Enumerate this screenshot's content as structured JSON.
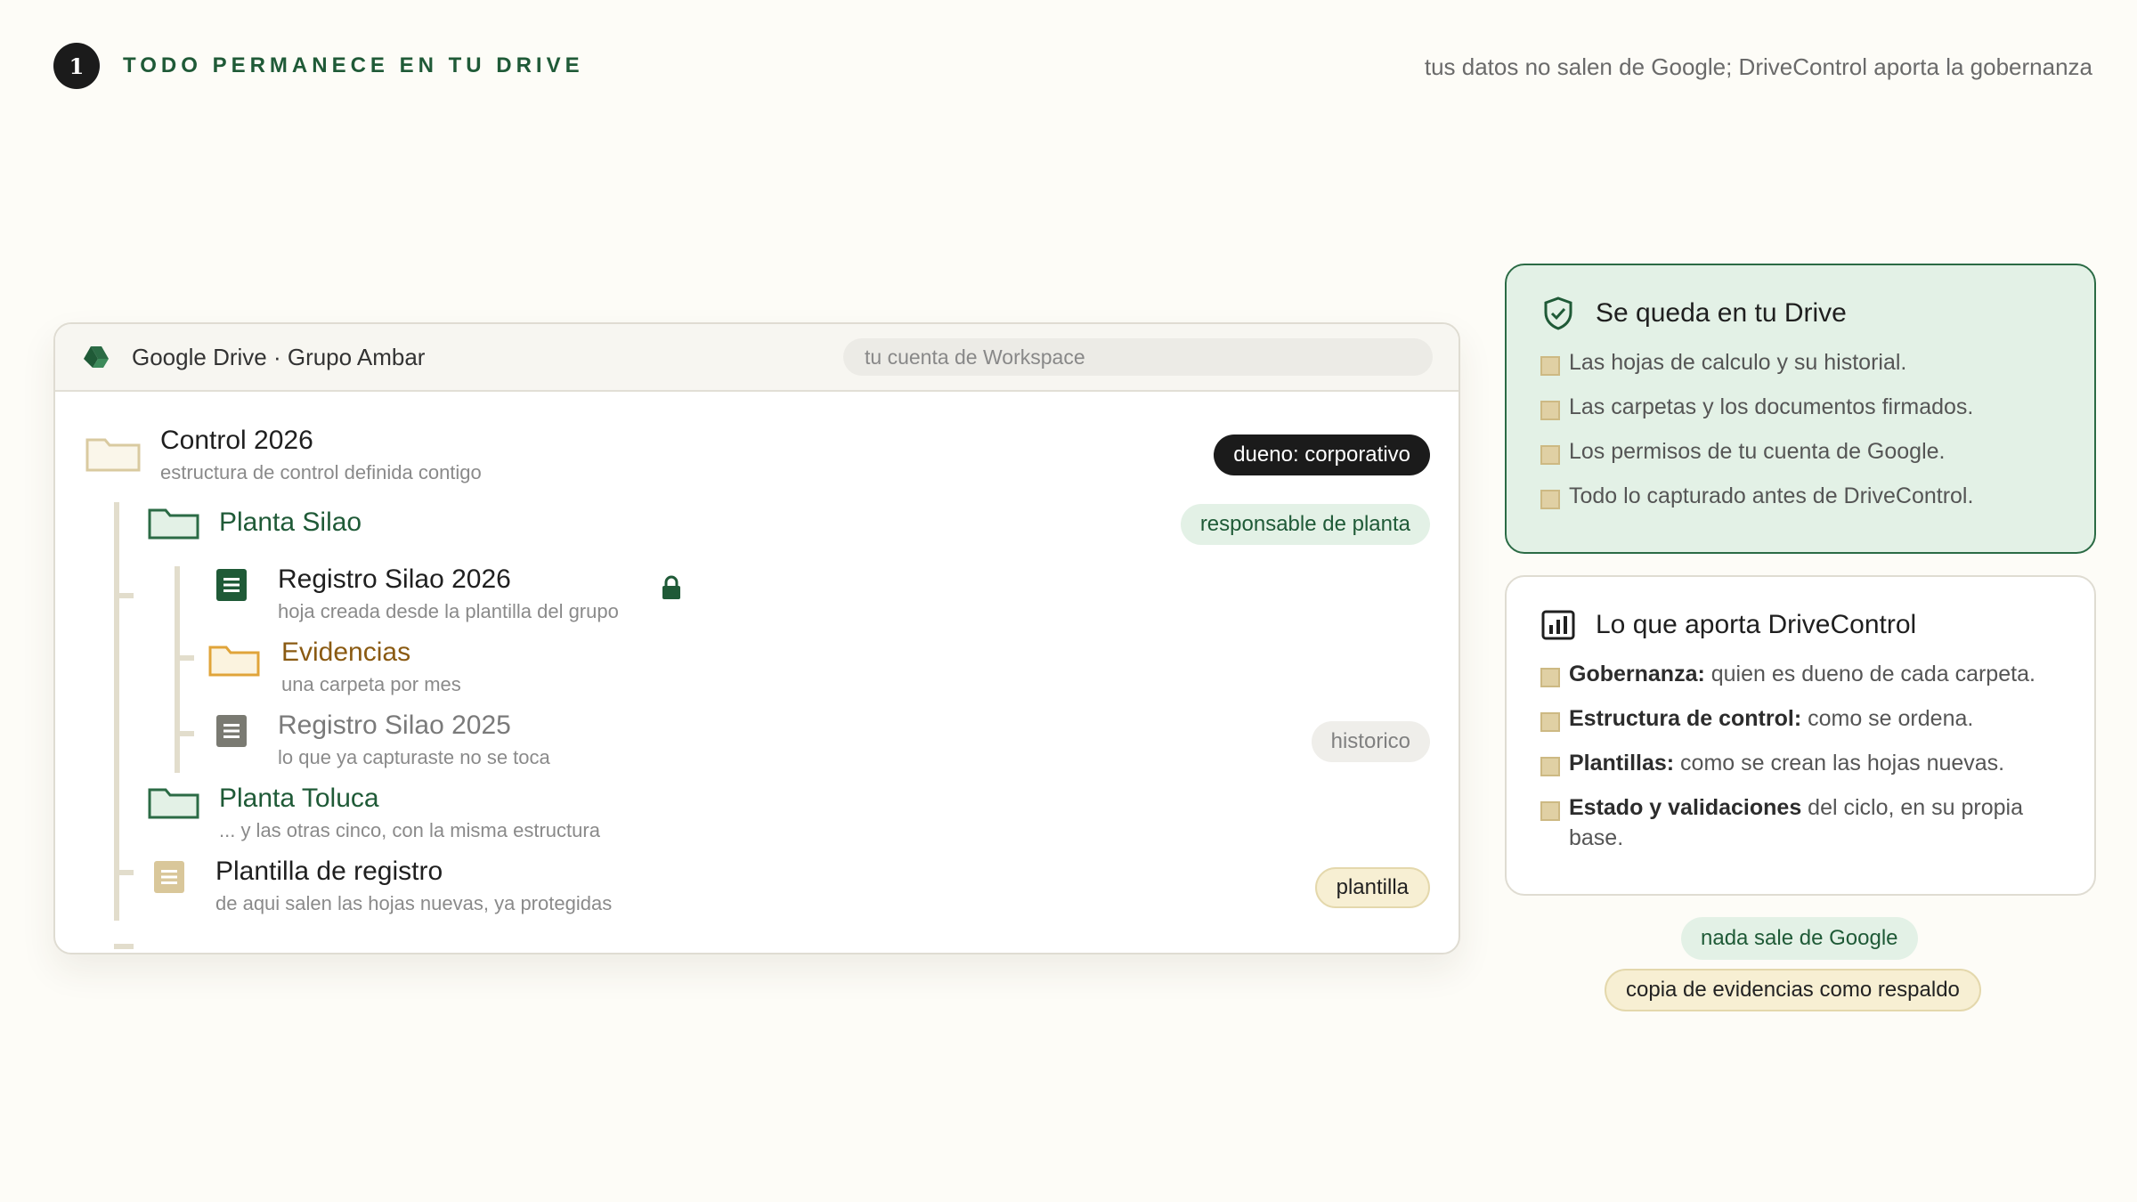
{
  "header": {
    "step_number": "1",
    "step_title": "TODO PERMANECE EN TU DRIVE",
    "note": "tus datos no salen de Google; DriveControl aporta la gobernanza"
  },
  "drive": {
    "title": "Google Drive · Grupo Ambar",
    "search_placeholder": "tu cuenta de Workspace",
    "items": [
      {
        "title": "Control 2026",
        "subtitle": "estructura de control definida contigo",
        "badge": "dueno: corporativo"
      },
      {
        "title": "Planta Silao",
        "subtitle": "",
        "badge": "responsable de planta"
      },
      {
        "title": "Registro Silao 2026",
        "subtitle": "hoja creada desde la plantilla del grupo",
        "badge": ""
      },
      {
        "title": "Evidencias",
        "subtitle": "una carpeta por mes",
        "badge": ""
      },
      {
        "title": "Registro Silao 2025",
        "subtitle": "lo que ya capturaste no se toca",
        "badge": "historico"
      },
      {
        "title": "Planta Toluca",
        "subtitle": "... y las otras cinco, con la misma estructura",
        "badge": ""
      },
      {
        "title": "Plantilla de registro",
        "subtitle": "de aqui salen las hojas nuevas, ya protegidas",
        "badge": "plantilla"
      }
    ]
  },
  "card_stays": {
    "title": "Se queda en tu Drive",
    "items": [
      "Las hojas de calculo y su historial.",
      "Las carpetas y los documentos firmados.",
      "Los permisos de tu cuenta de Google.",
      "Todo lo capturado antes de DriveControl."
    ]
  },
  "card_adds": {
    "title": "Lo que aporta DriveControl",
    "items": [
      {
        "label": "Gobernanza:",
        "text": " quien es dueno de cada carpeta."
      },
      {
        "label": "Estructura de control:",
        "text": " como se ordena."
      },
      {
        "label": "Plantillas:",
        "text": " como se crean las hojas nuevas."
      },
      {
        "label": "Estado y validaciones",
        "text": " del ciclo, en su propia base."
      }
    ]
  },
  "tags": {
    "stays_google": "nada sale de Google",
    "backup": "copia de evidencias como respaldo"
  },
  "colors": {
    "brand_green": "#1f5a37",
    "folder_beige": "#e0d0a4",
    "folder_amber": "#e0a43a",
    "background": "#fdfcf7"
  }
}
